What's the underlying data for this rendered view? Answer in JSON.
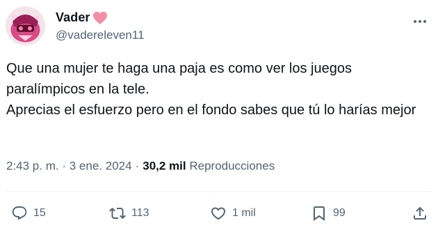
{
  "author": {
    "display_name": "Vader",
    "handle": "@vadereleven11",
    "badge_icon": "pink-heart-icon",
    "badge_color": "#f28fa7"
  },
  "tweet": {
    "lines": [
      "Que una mujer te haga una paja es como ver los juegos paralímpicos en la tele.",
      "Aprecias el esfuerzo pero en el fondo sabes que tú lo harías mejor"
    ]
  },
  "meta": {
    "time": "2:43 p. m.",
    "separator": "·",
    "date": "3 ene. 2024",
    "views_count": "30,2 mil",
    "views_label": "Reproducciones"
  },
  "actions": {
    "replies": "15",
    "retweets": "113",
    "likes": "1 mil",
    "bookmarks": "99"
  },
  "colors": {
    "text": "#0f1419",
    "secondary": "#536471",
    "divider": "#eff3f4"
  }
}
